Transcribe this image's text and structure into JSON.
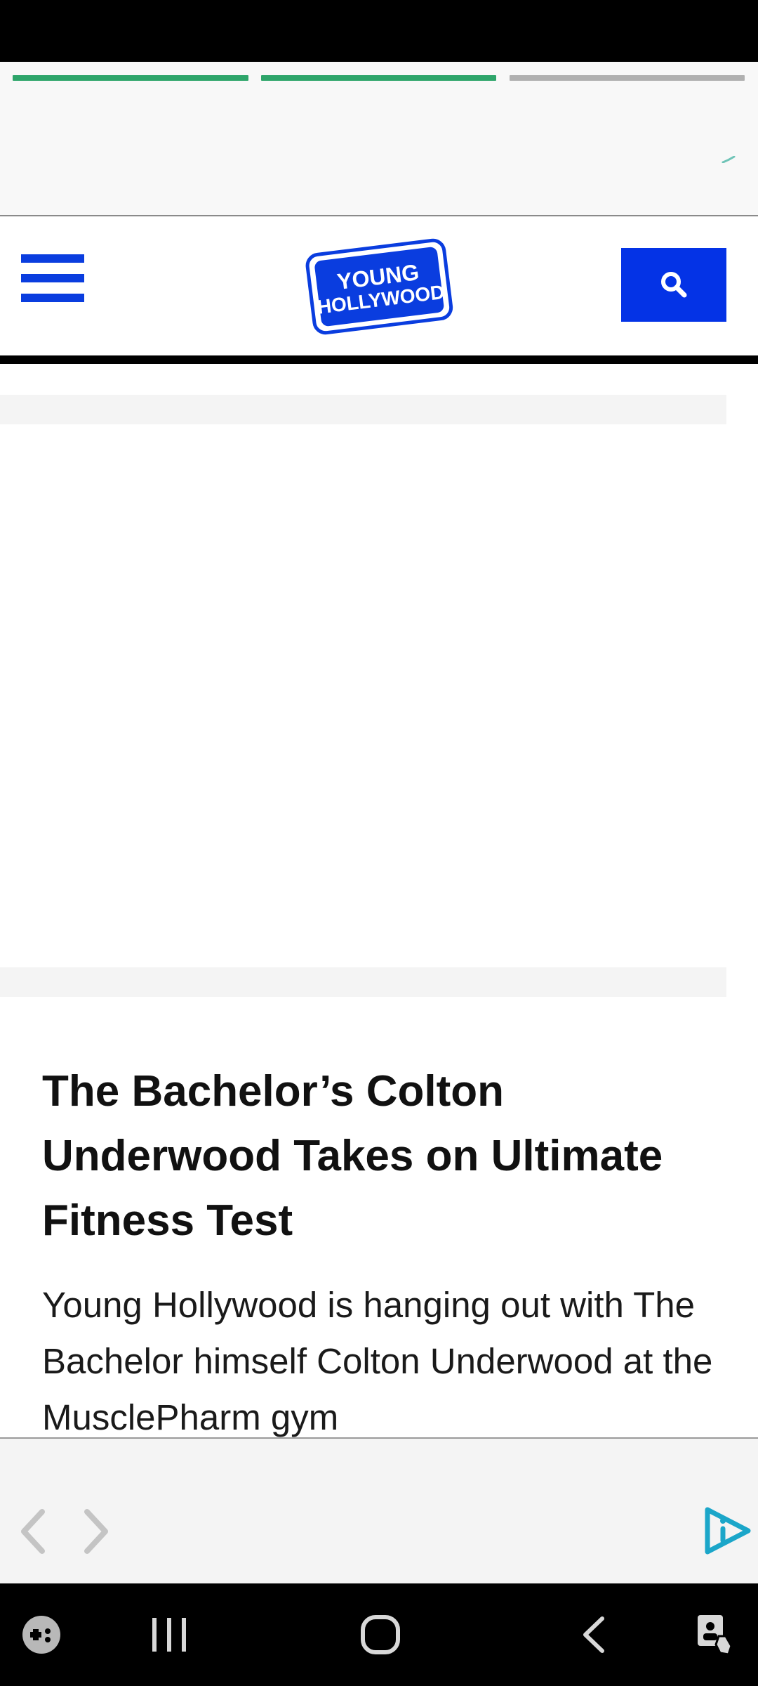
{
  "story": {
    "progress": [
      {
        "state": "complete",
        "color": "#2ea56a"
      },
      {
        "state": "complete",
        "color": "#2ea56a"
      },
      {
        "state": "pending",
        "color": "#b0b0b0"
      }
    ]
  },
  "header": {
    "menu_icon": "hamburger-menu-icon",
    "logo": {
      "line1": "YOUNG",
      "line2": "HOLLYWOOD"
    },
    "search_icon": "search-icon"
  },
  "article": {
    "title": "The Bachelor’s Colton Underwood Takes on Ultimate Fitness Test",
    "excerpt": "Young Hollywood is hanging out with The Bachelor himself Colton Underwood at the MusclePharm gym"
  },
  "bottom_bar": {
    "back_icon": "chevron-left-icon",
    "forward_icon": "chevron-right-icon",
    "brand_icon": "play-info-icon"
  },
  "system_nav": {
    "icons": [
      "game-launcher-icon",
      "recent-apps-icon",
      "home-icon",
      "back-icon",
      "accessibility-icon"
    ]
  },
  "colors": {
    "brand_blue": "#0433e6",
    "progress_green": "#2ea56a",
    "accent_teal": "#1ba6c9"
  }
}
